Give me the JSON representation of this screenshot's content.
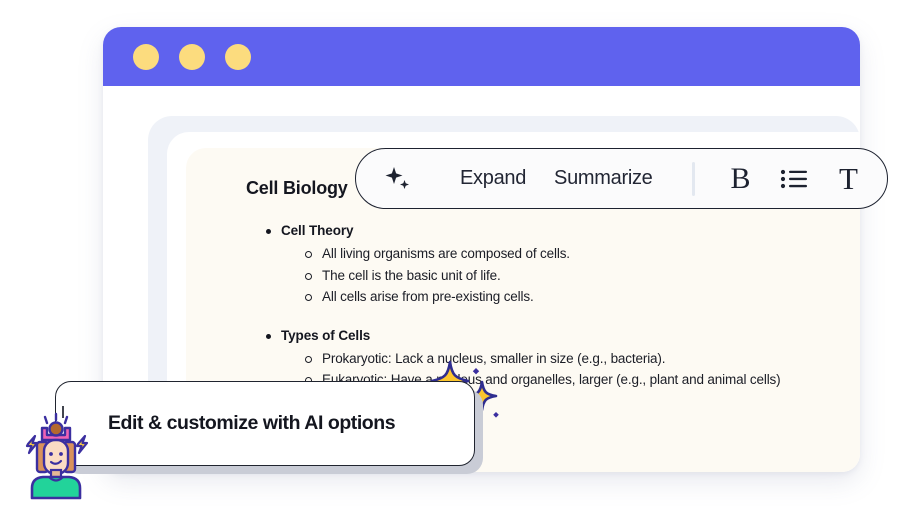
{
  "window": {
    "titlebar": {
      "dots": [
        "dot-yellow-1",
        "dot-yellow-2",
        "dot-yellow-3"
      ],
      "color": "#5f62ee",
      "dot_color": "#fcdc7e"
    },
    "panel_color": "#eff2f8",
    "document_color": "#fdfaf3"
  },
  "document": {
    "title": "Cell Biology",
    "sections": [
      {
        "heading": "Cell Theory",
        "items": [
          "All living organisms are composed of cells.",
          "The cell is the basic unit of life.",
          "All cells arise from pre-existing cells."
        ]
      },
      {
        "heading": "Types of Cells",
        "items": [
          "Prokaryotic: Lack a nucleus, smaller in size (e.g., bacteria).",
          "Eukaryotic: Have a nucleus and organelles, larger (e.g., plant and animal cells)"
        ]
      }
    ]
  },
  "toolbar": {
    "sparkle_icon": "sparkle-icon",
    "expand_label": "Expand",
    "summarize_label": "Summarize",
    "bold_label": "B",
    "list_icon": "bulleted-list-icon",
    "text_label": "T",
    "border_color": "#1d2230",
    "background": "#fbfbfc"
  },
  "callout": {
    "text": "Edit & customize with AI options",
    "border_color": "#20242f",
    "shadow_color": "#c9ccd6"
  },
  "decorations": {
    "sparkle_color": "#fcc62d",
    "sparkle_outline": "#2f2d8f",
    "diamond_color": "#3b2fa0",
    "mascot_name": "person-with-ideas-illustration",
    "mascot_shirt": "#22d39a",
    "mascot_hair": "#d9925c",
    "mascot_skin": "#fbdcc4",
    "mascot_accent": "#ef62b4",
    "mascot_bolt": "#ffd23f",
    "mascot_outline": "#3b2fa0"
  }
}
